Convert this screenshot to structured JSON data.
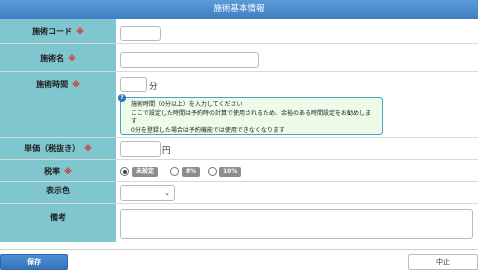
{
  "header": {
    "title": "施術基本情報"
  },
  "form": {
    "code": {
      "label": "施術コード",
      "required_mark": "※",
      "value": ""
    },
    "name": {
      "label": "施術名",
      "required_mark": "※",
      "value": ""
    },
    "duration": {
      "label": "施術時間",
      "required_mark": "※",
      "value": "",
      "unit": "分",
      "info_icon": "?",
      "info": [
        "施術時間（0分以上）を入力してください",
        "ここで設定した時間は予約時の計算で使用されるため、余裕のある時間設定をお勧めします",
        "0分を登録した場合は予約機能では使用できなくなります"
      ]
    },
    "price": {
      "label": "単価（税抜き）",
      "required_mark": "※",
      "value": "",
      "unit": "円"
    },
    "tax": {
      "label": "税率",
      "required_mark": "※",
      "options": [
        "未設定",
        "8%",
        "10%"
      ],
      "selected_index": 0
    },
    "color": {
      "label": "表示色",
      "value": ""
    },
    "notes": {
      "label": "備考",
      "value": ""
    }
  },
  "actions": {
    "save_label": "保存",
    "cancel_label": "中止"
  },
  "colors": {
    "header": "#3f7fc2",
    "label_bg": "#7fc6cf",
    "required": "#e2231a",
    "info_bg": "#effbe9"
  }
}
